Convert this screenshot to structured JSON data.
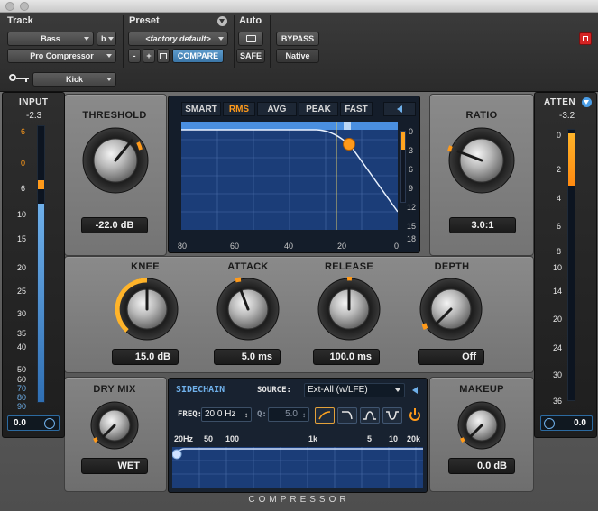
{
  "header": {
    "track_label": "Track",
    "preset_label": "Preset",
    "auto_label": "Auto",
    "track_name": "Bass",
    "track_channel": "b",
    "plugin_name": "Pro Compressor",
    "preset_name": "<factory default>",
    "minus": "-",
    "plus": "+",
    "compare": "COMPARE",
    "safe": "SAFE",
    "bypass": "BYPASS",
    "native": "Native",
    "key_input": "Kick"
  },
  "input_meter": {
    "title": "INPUT",
    "value": "-2.3",
    "field_value": "0.0",
    "scale": [
      "6",
      "0",
      "6",
      "10",
      "15",
      "20",
      "25",
      "30",
      "35",
      "40",
      "50",
      "60",
      "70",
      "80",
      "90"
    ],
    "level_fraction": 0.72
  },
  "atten_meter": {
    "title": "ATTEN",
    "value": "-3.2",
    "field_value": "0.0",
    "scale": [
      "0",
      "2",
      "4",
      "6",
      "8",
      "10",
      "14",
      "20",
      "24",
      "30",
      "36"
    ]
  },
  "threshold": {
    "label": "THRESHOLD",
    "value": "-22.0 dB"
  },
  "ratio": {
    "label": "RATIO",
    "value": "3.0:1"
  },
  "knee": {
    "label": "KNEE",
    "value": "15.0 dB"
  },
  "attack": {
    "label": "ATTACK",
    "value": "5.0 ms"
  },
  "release": {
    "label": "RELEASE",
    "value": "100.0 ms"
  },
  "depth": {
    "label": "DEPTH",
    "value": "Off"
  },
  "dry_mix": {
    "label": "DRY MIX",
    "value": "WET"
  },
  "makeup": {
    "label": "MAKEUP",
    "value": "0.0 dB"
  },
  "graph": {
    "modes": [
      "SMART",
      "RMS",
      "AVG",
      "PEAK",
      "FAST"
    ],
    "active_mode": "RMS",
    "x_ticks": [
      "80",
      "60",
      "40",
      "20",
      "0"
    ],
    "y_ticks": [
      "0",
      "3",
      "6",
      "9",
      "12",
      "15",
      "18"
    ]
  },
  "sidechain": {
    "title": "SIDECHAIN",
    "source_label": "SOURCE:",
    "source_value": "Ext-All (w/LFE)",
    "freq_label": "FREQ:",
    "freq_value": "20.0 Hz",
    "q_label": "Q:",
    "q_value": "5.0",
    "freq_ticks": [
      "20Hz",
      "50",
      "100",
      "1k",
      "5",
      "10",
      "20k"
    ]
  },
  "footer": "COMPRESSOR",
  "colors": {
    "accent_orange": "#ff9a1a",
    "accent_blue": "#4a9ee8",
    "panel_grey": "#7d7d7d"
  }
}
